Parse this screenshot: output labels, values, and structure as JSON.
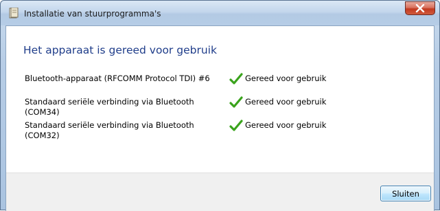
{
  "window": {
    "title": "Installatie van stuurprogramma's"
  },
  "dialog": {
    "heading": "Het apparaat is gereed voor gebruik",
    "devices": [
      {
        "name": "Bluetooth-apparaat (RFCOMM Protocol TDI) #6",
        "status": "Gereed voor gebruik"
      },
      {
        "name": "Standaard seriële verbinding via Bluetooth (COM34)",
        "status": "Gereed voor gebruik"
      },
      {
        "name": "Standaard seriële verbinding via Bluetooth (COM32)",
        "status": "Gereed voor gebruik"
      }
    ],
    "close_label": "Sluiten"
  },
  "colors": {
    "heading": "#1f3d8a",
    "check": "#3aa31c",
    "close_button": "#c2391f"
  },
  "icons": {
    "title": "driver-install-icon",
    "status": "checkmark-icon",
    "close": "close-x-icon"
  }
}
